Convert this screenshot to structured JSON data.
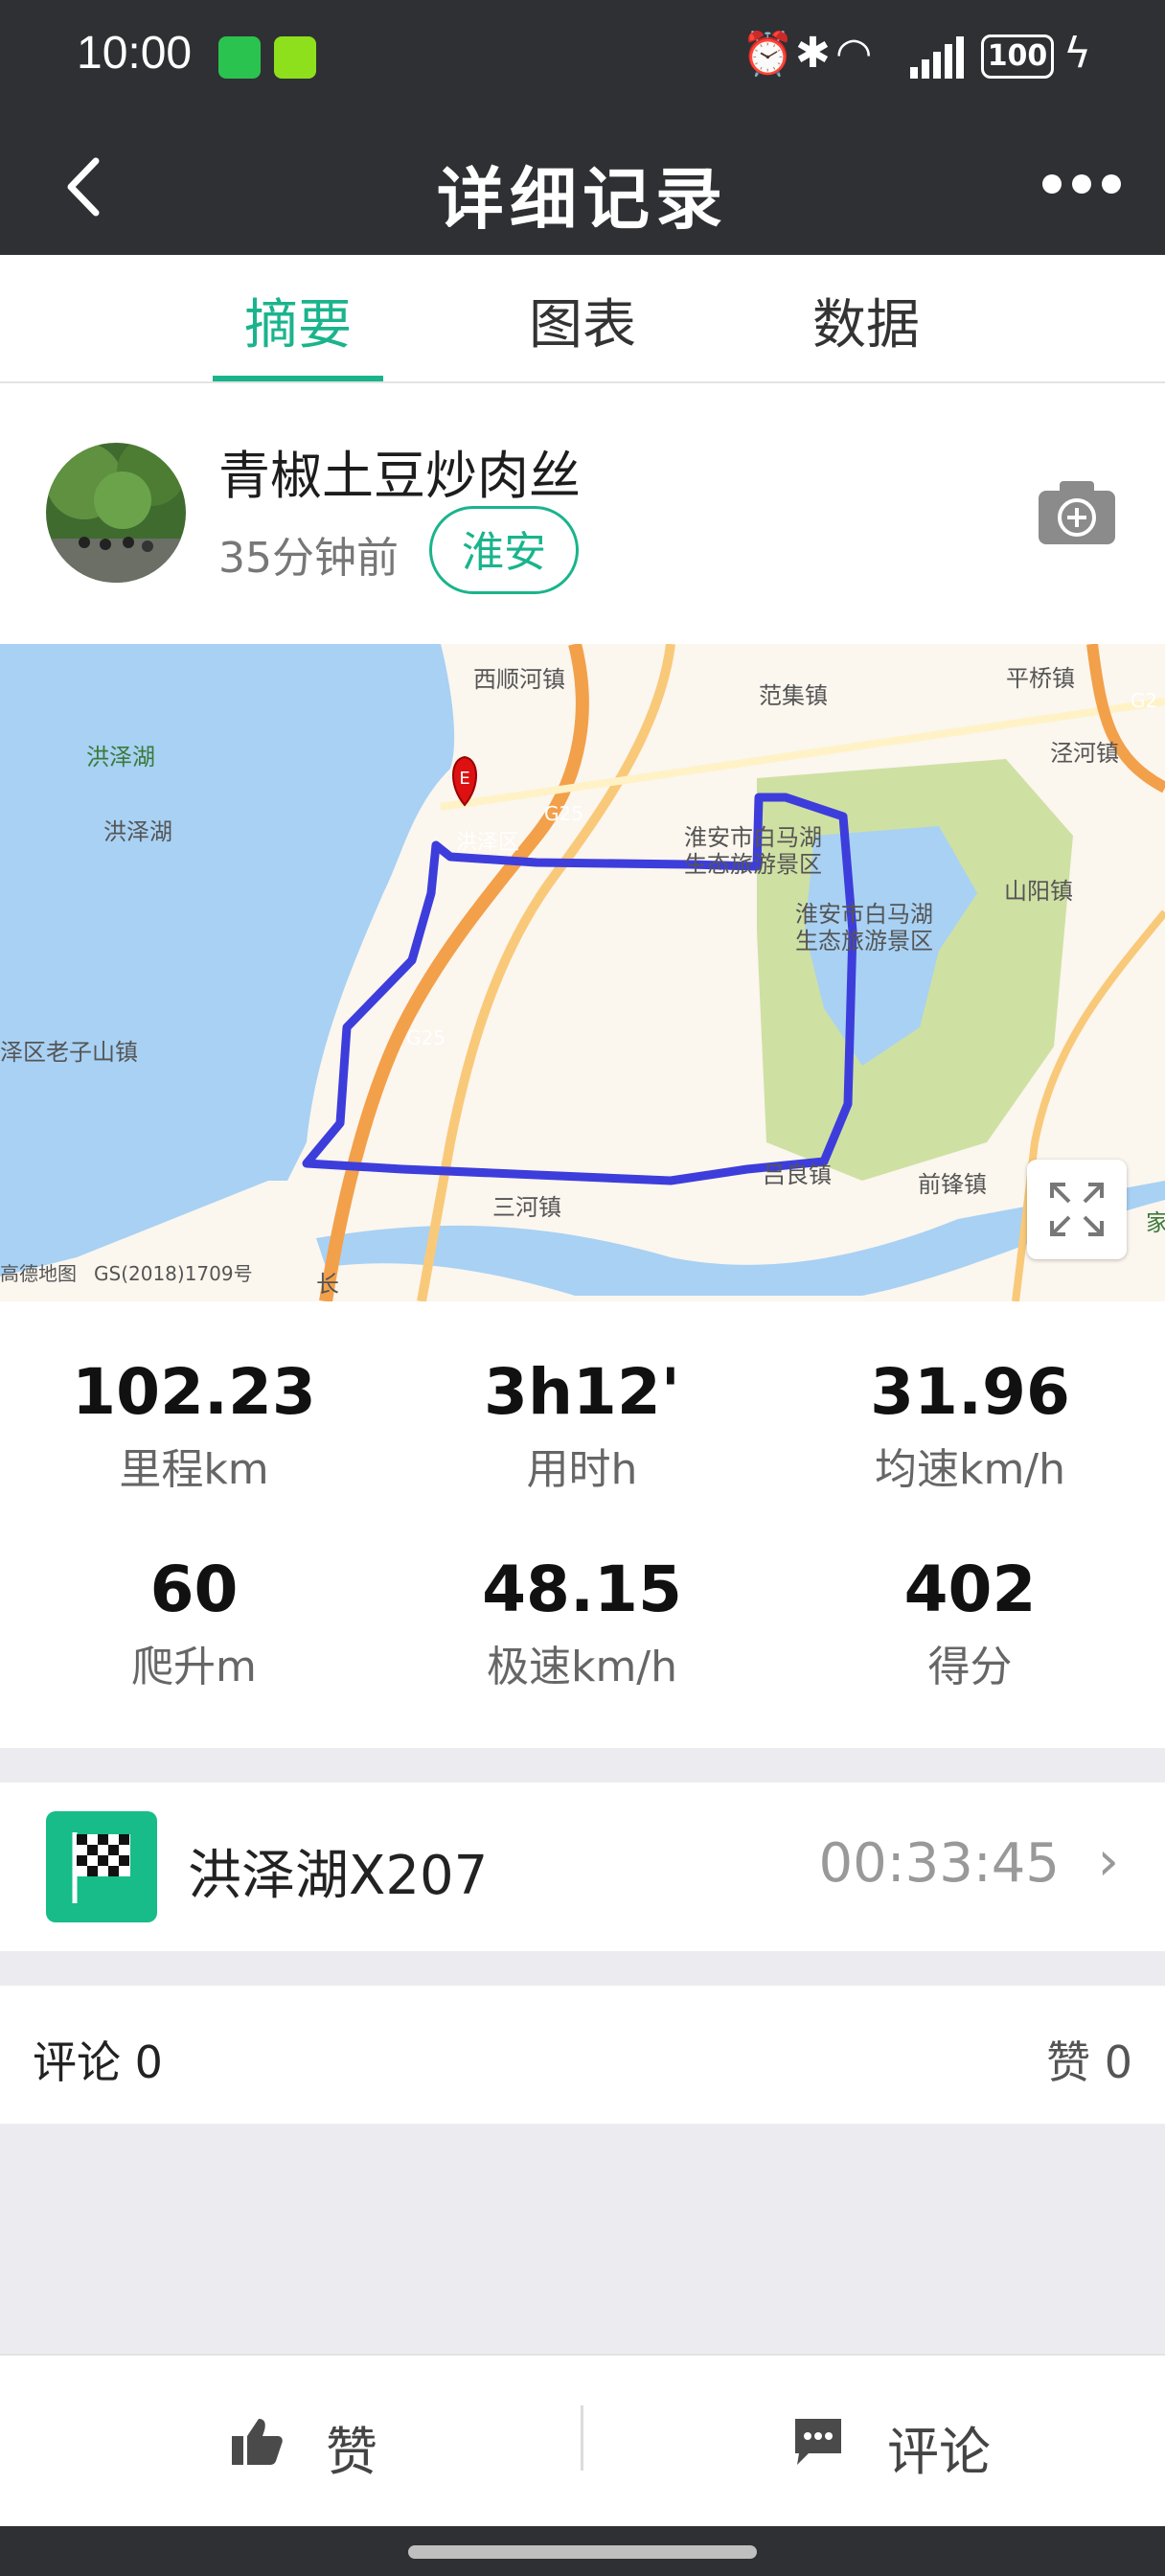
{
  "status_bar": {
    "time": "10:00",
    "battery": "100"
  },
  "app_bar": {
    "title": "详细记录"
  },
  "tabs": [
    {
      "label": "摘要",
      "active": true
    },
    {
      "label": "图表",
      "active": false
    },
    {
      "label": "数据",
      "active": false
    }
  ],
  "profile": {
    "username": "青椒土豆炒肉丝",
    "time_ago": "35分钟前",
    "city": "淮安"
  },
  "map": {
    "labels": [
      "西顺河镇",
      "范集镇",
      "平桥镇",
      "洪泽湖",
      "洪泽湖",
      "泾河镇",
      "G25",
      "淮安市白马湖",
      "生态旅游景区",
      "淮安市白马湖",
      "生态旅游景区",
      "山阳镇",
      "洪泽区",
      "泽区老子山镇",
      "G25",
      "三河镇",
      "吕良镇",
      "前锋镇",
      "高德地图",
      "GS(2018)1709号",
      "G2",
      "长",
      "家"
    ],
    "end_marker": "E"
  },
  "stats": [
    {
      "value": "102.23",
      "label": "里程km"
    },
    {
      "value": "3h12'",
      "label": "用时h"
    },
    {
      "value": "31.96",
      "label": "均速km/h"
    },
    {
      "value": "60",
      "label": "爬升m"
    },
    {
      "value": "48.15",
      "label": "极速km/h"
    },
    {
      "value": "402",
      "label": "得分"
    }
  ],
  "segment": {
    "name": "洪泽湖X207",
    "time": "00:33:45"
  },
  "comments": {
    "comment_label": "评论 0",
    "like_label": "赞 0"
  },
  "bottom_bar": {
    "like": "赞",
    "comment": "评论"
  }
}
